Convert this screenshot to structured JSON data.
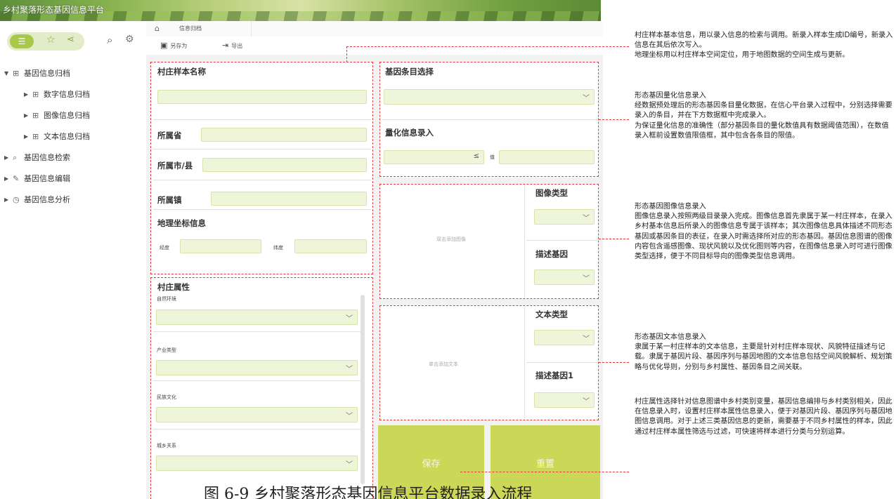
{
  "banner": {
    "title": "乡村聚落形态基因信息平台"
  },
  "sidebar": {
    "pill_active_icon": "list-icon",
    "tree": [
      {
        "label": "基因信息归档",
        "level": 1,
        "expanded": true,
        "icon": "grid-icon"
      },
      {
        "label": "数字信息归档",
        "level": 2,
        "icon": "grid-icon"
      },
      {
        "label": "图像信息归档",
        "level": 2,
        "icon": "grid-icon"
      },
      {
        "label": "文本信息归档",
        "level": 2,
        "icon": "grid-icon"
      },
      {
        "label": "基因信息检索",
        "level": 1,
        "icon": "search-doc-icon"
      },
      {
        "label": "基因信息编辑",
        "level": 1,
        "icon": "edit-icon"
      },
      {
        "label": "基因信息分析",
        "level": 1,
        "icon": "clock-icon"
      }
    ]
  },
  "tabbar": {
    "tab_label": "信息归档"
  },
  "toolbar": {
    "save_as": "另存为",
    "export": "导出"
  },
  "form": {
    "village_name": "村庄样本名称",
    "province": "所属省",
    "city": "所属市/县",
    "town": "所属镇",
    "geo": "地理坐标信息",
    "longitude": "经度",
    "latitude": "纬度",
    "attr_title": "村庄属性",
    "attr_natural": "自然环境",
    "attr_industry": "产业类型",
    "attr_culture": "民族文化",
    "attr_urban": "城乡关系",
    "gene_select": "基因条目选择",
    "quant_input": "量化信息录入",
    "quant_op": "≤",
    "quant_value": "值",
    "image_drop": "双击添加图像",
    "image_type": "图像类型",
    "image_gene": "描述基因",
    "text_drop": "单击添加文本",
    "text_type": "文本类型",
    "text_gene": "描述基因1",
    "save": "保存",
    "reset": "重置"
  },
  "annotations": {
    "a1": "村庄样本基本信息，用以录入信息的检索与调用。新录入样本生成ID编号，新录入信息在其后依次写入。\n地理坐标用以村庄样本空间定位，用于地图数据的空间生成与更新。",
    "a2": "形态基因量化信息录入\n经数据预处理后的形态基因条目量化数据，在信心平台录入过程中，分别选择需要录入的条目，并在下方数据框中完成录入。\n为保证量化信息的准确性（部分基因条目的量化数值具有数据阈值范围），在数值录入框前设置数值限值框，其中包含各条目的限值。",
    "a3": "形态基因图像信息录入\n图像信息录入按照两级目录录入完成。图像信息首先隶属于某一村庄样本，在录入乡村基本信息后所录入的图像信息专属于该样本；其次图像信息具体描述不同形态基因或基因条目的表征，在录入时需选择所对应的形态基因。基因信息图谱的图像内容包含遥感图像、现状风貌以及优化图则等内容，在图像信息录入时可进行图像类型选择，便于不同目标导向的图像类型信息调用。",
    "a4": "形态基因文本信息录入\n隶属于某一村庄样本的文本信息，主要是针对村庄样本现状、风貌特征描述与记载。隶属于基因片段、基因序列与基因地图的文本信息包括空间风貌解析、规划策略与优化导则，分别与乡村属性、基因条目之间关联。",
    "a5": "村庄属性选择针对信息图谱中乡村类别变量，基因信息编排与乡村类别相关，因此在信息录入时，设置村庄样本属性信息录入，便于对基因片段、基因序列与基因地图信息调用。对于上述三类基因信息的更新，需要基于不同乡村属性的样本，因此通过村庄样本属性筛选与过滤，可快速将样本进行分类与分别运算。"
  },
  "caption": "图 6-9  乡村聚落形态基因信息平台数据录入流程",
  "colors": {
    "accent": "#a8c84c",
    "input_bg": "#eff5d8",
    "button": "#cbd857",
    "annotation_line": "#e23b3b"
  }
}
